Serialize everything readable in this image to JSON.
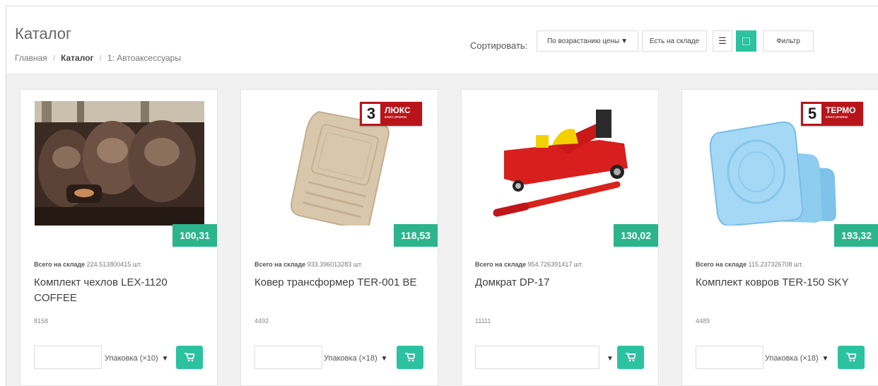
{
  "header": {
    "title": "Каталог",
    "breadcrumb": [
      "Главная",
      "Каталог",
      "1: Автоаксессуары"
    ]
  },
  "toolbar": {
    "sort_label": "Сортировать:",
    "sort_value": "По возрастанию цены",
    "in_stock": "Есть на складе",
    "list_icon": "list-icon",
    "grid_icon": "grid-icon",
    "filter": "Фильтр"
  },
  "colors": {
    "accent": "#2cc2a0",
    "price_bg": "#2cb48c",
    "badge_red": "#b8151b"
  },
  "products": [
    {
      "price": "100,31",
      "stock_label": "Всего на складе",
      "stock_value": "224.513800415 шт.",
      "name": "Комплект чехлов LEX-1120 COFFEE",
      "sku": "8158",
      "pack": "Упаковка (×10)"
    },
    {
      "price": "118,53",
      "stock_label": "Всего на складе",
      "stock_value": "933.396013283 шт.",
      "name": "Ковер трансформер TER-001 BE",
      "sku": "4492",
      "pack": "Упаковка (×18)",
      "badge_num": "3",
      "badge_text": "ЛЮКС",
      "badge_sub": "класс резины"
    },
    {
      "price": "130,02",
      "stock_label": "Всего на складе",
      "stock_value": "954.726391417 шт.",
      "name": "Домкрат DP-17",
      "sku": "11111",
      "pack": ""
    },
    {
      "price": "193,32",
      "stock_label": "Всего на складе",
      "stock_value": "115.237326708 шт.",
      "name": "Комплект ковров TER-150 SKY",
      "sku": "4489",
      "pack": "Упаковка (×18)",
      "badge_num": "5",
      "badge_text": "ТЕРМО",
      "badge_sub": "класс резины"
    }
  ]
}
